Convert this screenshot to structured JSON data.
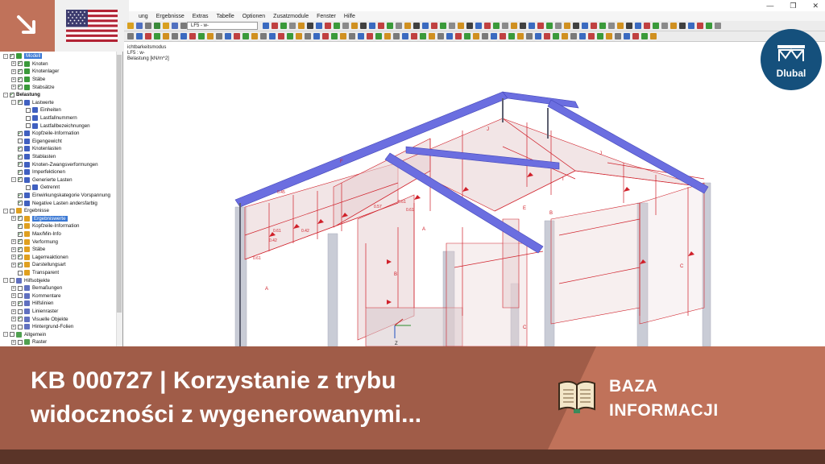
{
  "brand": {
    "corner_icon": "arrow-down-right-icon",
    "flag": "us-flag-icon",
    "logo_text": "Dlubal",
    "colors": {
      "accent": "#c0725a",
      "banner": "#a05c48",
      "logo": "#15507c"
    }
  },
  "window": {
    "menu": [
      "ung",
      "Ergebnisse",
      "Extras",
      "Tabelle",
      "Optionen",
      "Zusatzmodule",
      "Fenster",
      "Hilfe"
    ],
    "loadcase_combo": "LF5 - w-"
  },
  "viewport": {
    "info_lines": [
      "ichtbarkeitsmodus",
      "LF5 : w-",
      "Belastung [kN/m^2]"
    ],
    "value_labels": [
      "0.45",
      "0.42",
      "0.61",
      "0.61",
      "0.61",
      "0.61",
      "0.57",
      "0.42"
    ],
    "region_labels": [
      "A",
      "B",
      "C",
      "A",
      "B",
      "C",
      "J",
      "J",
      "I",
      "F",
      "E"
    ]
  },
  "navigator": {
    "rows": [
      {
        "label": "Modell",
        "level": 0,
        "exp": "-",
        "check": true,
        "icon": "model-icon",
        "selected": true,
        "bold": false
      },
      {
        "label": "Knoten",
        "level": 1,
        "exp": "+",
        "check": true,
        "icon": "node-icon"
      },
      {
        "label": "Knotenlager",
        "level": 1,
        "exp": "+",
        "check": true,
        "icon": "support-icon"
      },
      {
        "label": "Stäbe",
        "level": 1,
        "exp": "+",
        "check": true,
        "icon": "member-icon"
      },
      {
        "label": "Stabsätze",
        "level": 1,
        "exp": "+",
        "check": true,
        "icon": "memberset-icon"
      },
      {
        "label": "Belastung",
        "level": 0,
        "exp": "-",
        "check": true,
        "icon": "",
        "bold": true
      },
      {
        "label": "Lastwerte",
        "level": 1,
        "exp": "-",
        "check": true,
        "icon": "load-icon"
      },
      {
        "label": "Einheiten",
        "level": 2,
        "exp": "",
        "check": false,
        "icon": "load-icon"
      },
      {
        "label": "Lastfallnummern",
        "level": 2,
        "exp": "",
        "check": false,
        "icon": "load-icon"
      },
      {
        "label": "Lastfallbezeichnungen",
        "level": 2,
        "exp": "",
        "check": false,
        "icon": "load-icon"
      },
      {
        "label": "Kopfzeile-Information",
        "level": 1,
        "exp": "",
        "check": true,
        "icon": "load-icon"
      },
      {
        "label": "Eigengewicht",
        "level": 1,
        "exp": "",
        "check": false,
        "icon": "load-icon"
      },
      {
        "label": "Knotenlasten",
        "level": 1,
        "exp": "",
        "check": true,
        "icon": "load-icon"
      },
      {
        "label": "Stablasten",
        "level": 1,
        "exp": "",
        "check": true,
        "icon": "load-icon"
      },
      {
        "label": "Knoten-Zwangsverformungen",
        "level": 1,
        "exp": "",
        "check": true,
        "icon": "load-icon"
      },
      {
        "label": "Imperfektionen",
        "level": 1,
        "exp": "",
        "check": true,
        "icon": "load-icon"
      },
      {
        "label": "Generierte Lasten",
        "level": 1,
        "exp": "-",
        "check": true,
        "icon": "load-icon"
      },
      {
        "label": "Getrennt",
        "level": 2,
        "exp": "",
        "check": false,
        "icon": "load-icon"
      },
      {
        "label": "Einwirkungskategorie Vorspannung",
        "level": 1,
        "exp": "",
        "check": true,
        "icon": "load-icon"
      },
      {
        "label": "Negative Lasten andersfarbig",
        "level": 1,
        "exp": "",
        "check": true,
        "icon": "load-icon"
      },
      {
        "label": "Ergebnisse",
        "level": 0,
        "exp": "-",
        "check": false,
        "icon": "results-icon"
      },
      {
        "label": "Ergebniswerte",
        "level": 1,
        "exp": "+",
        "check": true,
        "icon": "results-icon",
        "selected": true
      },
      {
        "label": "Kopfzeile-Information",
        "level": 1,
        "exp": "",
        "check": true,
        "icon": "results-icon"
      },
      {
        "label": "Max/Min-Info",
        "level": 1,
        "exp": "",
        "check": true,
        "icon": "results-icon"
      },
      {
        "label": "Verformung",
        "level": 1,
        "exp": "+",
        "check": true,
        "icon": "results-icon"
      },
      {
        "label": "Stäbe",
        "level": 1,
        "exp": "+",
        "check": true,
        "icon": "results-icon"
      },
      {
        "label": "Lagerreaktionen",
        "level": 1,
        "exp": "+",
        "check": true,
        "icon": "results-icon"
      },
      {
        "label": "Darstellungsart",
        "level": 1,
        "exp": "+",
        "check": true,
        "icon": "results-icon"
      },
      {
        "label": "Transparent",
        "level": 1,
        "exp": "",
        "check": false,
        "icon": "results-icon"
      },
      {
        "label": "Hilfsobjekte",
        "level": 0,
        "exp": "-",
        "check": false,
        "icon": "guide-icon"
      },
      {
        "label": "Bemaßungen",
        "level": 1,
        "exp": "+",
        "check": false,
        "icon": "guide-icon"
      },
      {
        "label": "Kommentare",
        "level": 1,
        "exp": "+",
        "check": false,
        "icon": "guide-icon"
      },
      {
        "label": "Hilfslinien",
        "level": 1,
        "exp": "+",
        "check": true,
        "icon": "guide-icon"
      },
      {
        "label": "Linienraster",
        "level": 1,
        "exp": "+",
        "check": false,
        "icon": "guide-icon"
      },
      {
        "label": "Visuelle Objekte",
        "level": 1,
        "exp": "+",
        "check": true,
        "icon": "guide-icon"
      },
      {
        "label": "Hintergrund-Folien",
        "level": 1,
        "exp": "+",
        "check": false,
        "icon": "guide-icon"
      },
      {
        "label": "Allgemein",
        "level": 0,
        "exp": "-",
        "check": false,
        "icon": "general-icon"
      },
      {
        "label": "Raster",
        "level": 1,
        "exp": "+",
        "check": false,
        "icon": "general-icon"
      }
    ]
  },
  "banner": {
    "title": "KB 000727 | Korzystanie z trybu widoczności z wygenerowanymi...",
    "category_line1": "BAZA",
    "category_line2": "INFORMACJI",
    "book_icon": "open-book-icon"
  }
}
